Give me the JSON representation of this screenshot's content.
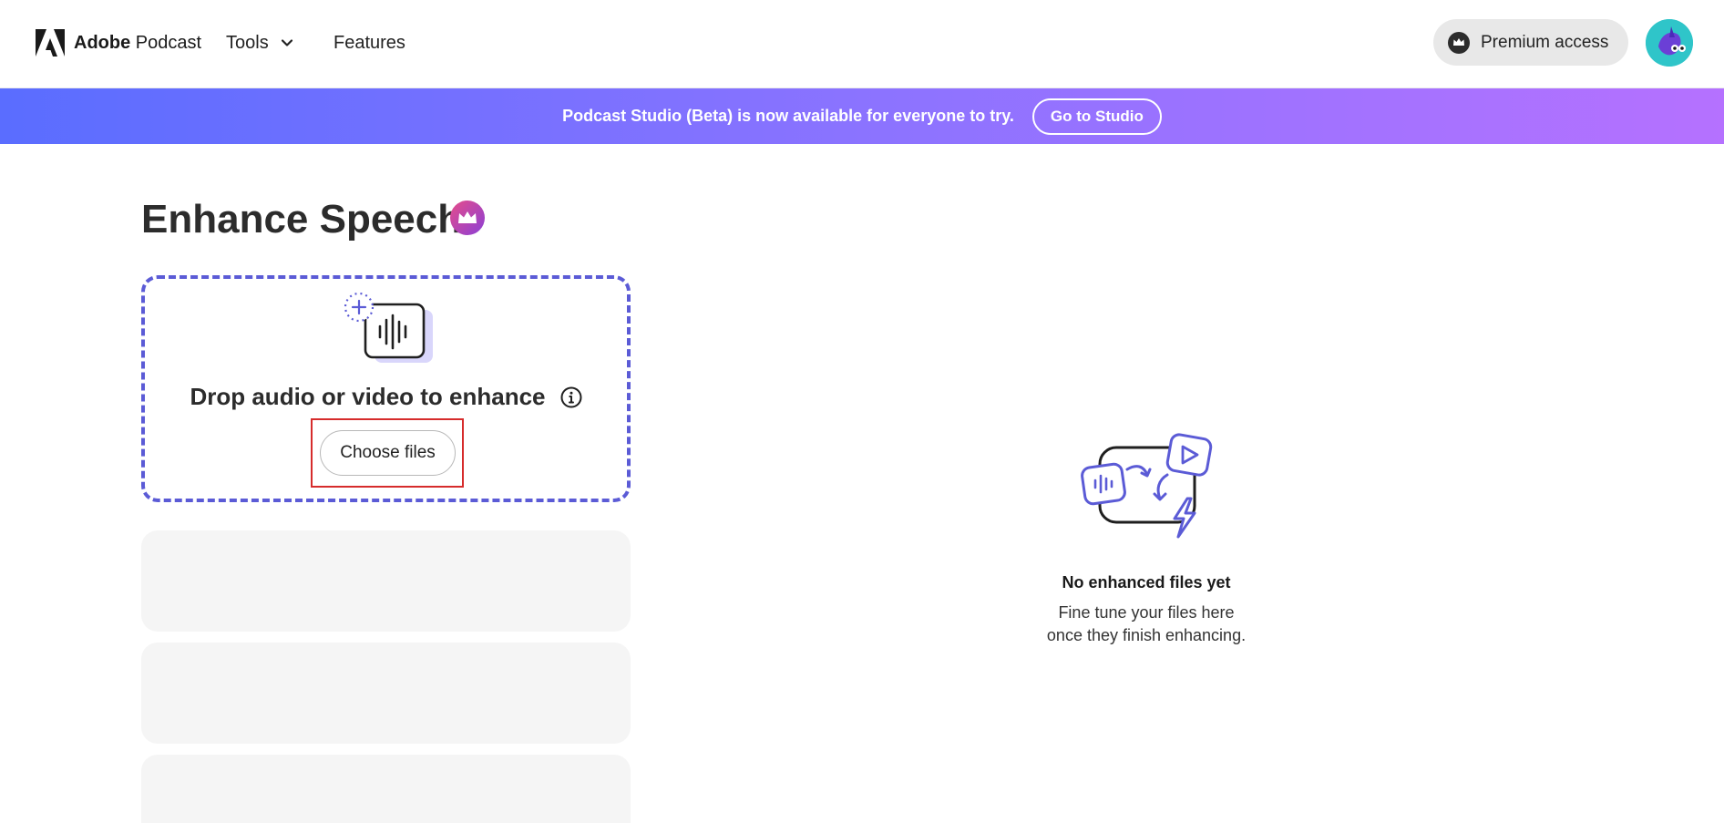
{
  "header": {
    "logo_brand": "Adobe",
    "logo_product": "Podcast",
    "nav_tools": "Tools",
    "nav_features": "Features",
    "premium_label": "Premium access",
    "icons": {
      "logo": "adobe-logo-icon",
      "tools_chevron": "chevron-down-icon",
      "premium": "premium-crown-icon",
      "avatar": "user-avatar"
    }
  },
  "banner": {
    "message": "Podcast Studio (Beta) is now available for everyone to try.",
    "button_label": "Go to Studio"
  },
  "main": {
    "title": "Enhance Speech",
    "dropzone": {
      "prompt": "Drop audio or video to enhance",
      "choose_button": "Choose files"
    }
  },
  "empty_state": {
    "title": "No enhanced files yet",
    "description_line1": "Fine tune your files here",
    "description_line2": "once they finish enhancing."
  },
  "colors": {
    "accent": "#5b5bd6",
    "banner_start": "#5a6dff",
    "banner_end": "#b571ff",
    "highlight": "#d62c2c",
    "skeleton": "#f5f5f5"
  }
}
